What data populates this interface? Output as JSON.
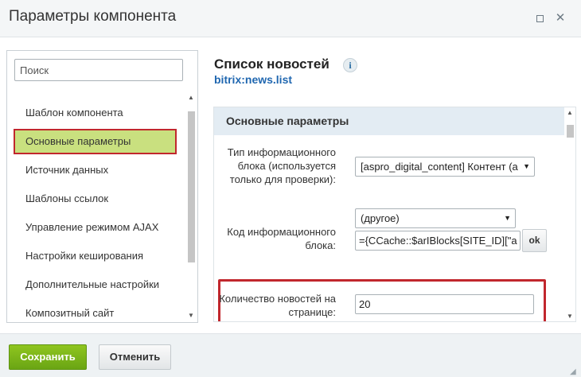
{
  "window": {
    "title": "Параметры компонента",
    "maximize_icon": "maximize-icon",
    "close_glyph": "✕"
  },
  "sidebar": {
    "search_placeholder": "Поиск",
    "items": [
      {
        "label": "Шаблон компонента"
      },
      {
        "label": "Основные параметры",
        "active": true
      },
      {
        "label": "Источник данных"
      },
      {
        "label": "Шаблоны ссылок"
      },
      {
        "label": "Управление режимом AJAX"
      },
      {
        "label": "Настройки кеширования"
      },
      {
        "label": "Дополнительные настройки"
      },
      {
        "label": "Композитный сайт"
      }
    ]
  },
  "component": {
    "title": "Список новостей",
    "code": "bitrix:news.list",
    "info_glyph": "i"
  },
  "section": {
    "title": "Основные параметры"
  },
  "params": {
    "iblock_type": {
      "label_line1": "Тип информационного",
      "label_line2": "блока (используется",
      "label_line3": "только для проверки):",
      "value": "[aspro_digital_content] Контент (a"
    },
    "iblock_code": {
      "label_line1": "Код информационного",
      "label_line2": "блока:",
      "select_value": "(другое)",
      "text_value": "={CCache::$arIBlocks[SITE_ID][\"a",
      "ok_label": "ok"
    },
    "news_count": {
      "label_line1": "Количество новостей на",
      "label_line2": "странице:",
      "value": "20"
    }
  },
  "footer": {
    "save_label": "Сохранить",
    "cancel_label": "Отменить"
  },
  "colors": {
    "active_item": "#c9e07f",
    "highlight_border": "#c1272d",
    "save_button": "#7ab51a",
    "link": "#2067b0"
  }
}
